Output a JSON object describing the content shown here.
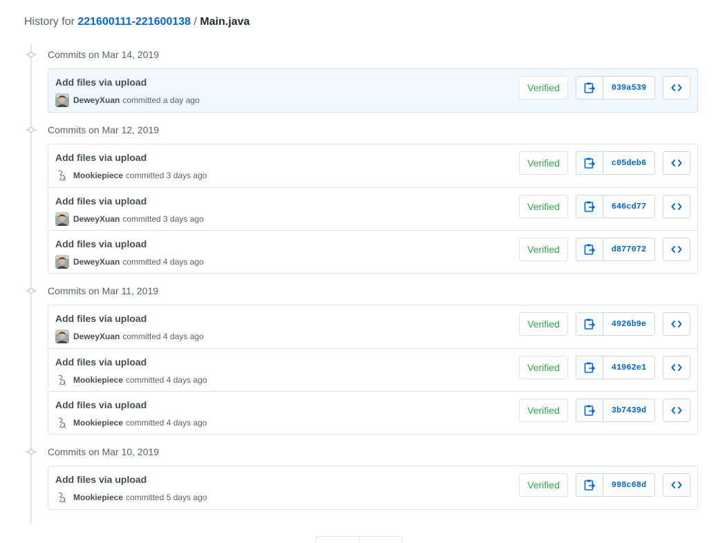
{
  "header": {
    "prefix": "History for ",
    "repo": "221600111-221600138",
    "separator": " / ",
    "file": "Main.java"
  },
  "groups": [
    {
      "title": "Commits on Mar 14, 2019",
      "highlight": true,
      "commits": [
        {
          "message": "Add files via upload",
          "author": "DeweyXuan",
          "avatar": "photo-avatar",
          "when": "committed a day ago",
          "badge": "Verified",
          "sha": "039a539"
        }
      ]
    },
    {
      "title": "Commits on Mar 12, 2019",
      "highlight": false,
      "commits": [
        {
          "message": "Add files via upload",
          "author": "Mookiepiece",
          "avatar": "sketch-avatar",
          "when": "committed 3 days ago",
          "badge": "Verified",
          "sha": "c05deb6"
        },
        {
          "message": "Add files via upload",
          "author": "DeweyXuan",
          "avatar": "photo-avatar",
          "when": "committed 3 days ago",
          "badge": "Verified",
          "sha": "646cd77"
        },
        {
          "message": "Add files via upload",
          "author": "DeweyXuan",
          "avatar": "photo-avatar",
          "when": "committed 4 days ago",
          "badge": "Verified",
          "sha": "d877072"
        }
      ]
    },
    {
      "title": "Commits on Mar 11, 2019",
      "highlight": false,
      "commits": [
        {
          "message": "Add files via upload",
          "author": "DeweyXuan",
          "avatar": "photo-avatar",
          "when": "committed 4 days ago",
          "badge": "Verified",
          "sha": "4926b9e"
        },
        {
          "message": "Add files via upload",
          "author": "Mookiepiece",
          "avatar": "sketch-avatar",
          "when": "committed 4 days ago",
          "badge": "Verified",
          "sha": "41962e1"
        },
        {
          "message": "Add files via upload",
          "author": "Mookiepiece",
          "avatar": "sketch-avatar",
          "when": "committed 4 days ago",
          "badge": "Verified",
          "sha": "3b7439d"
        }
      ]
    },
    {
      "title": "Commits on Mar 10, 2019",
      "highlight": false,
      "commits": [
        {
          "message": "Add files via upload",
          "author": "Mookiepiece",
          "avatar": "sketch-avatar",
          "when": "committed 5 days ago",
          "badge": "Verified",
          "sha": "998c68d"
        }
      ]
    }
  ],
  "icons": {
    "copy": "clipboard-copy-icon",
    "browse": "code-icon",
    "timeline": "git-commit-icon"
  },
  "colors": {
    "link": "#0366d6",
    "verified": "#28a745",
    "highlight_bg": "#f1f8ff"
  }
}
